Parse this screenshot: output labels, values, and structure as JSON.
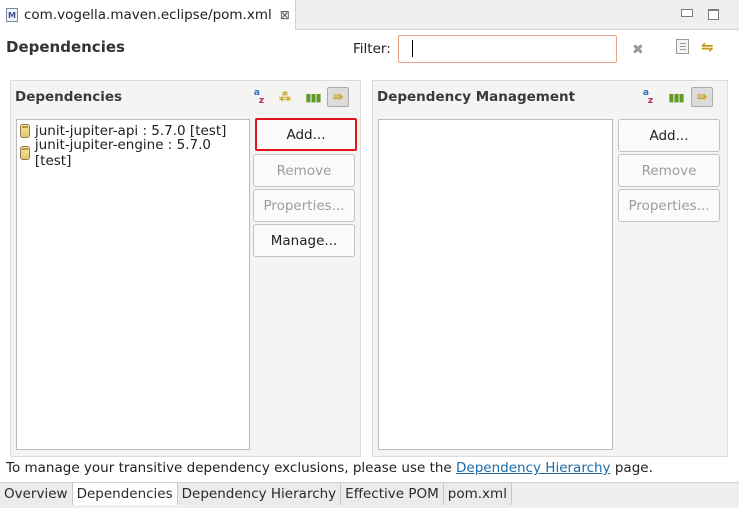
{
  "editor_tab": {
    "icon": "maven-pom-icon",
    "title": "com.vogella.maven.eclipse/pom.xml",
    "close": "⊠"
  },
  "page": {
    "title": "Dependencies",
    "filter_label": "Filter:",
    "filter_value": ""
  },
  "dependencies": {
    "title": "Dependencies",
    "items": [
      {
        "label": "junit-jupiter-api : 5.7.0 [test]"
      },
      {
        "label": "junit-jupiter-engine : 5.7.0 [test]"
      }
    ],
    "buttons": {
      "add": "Add...",
      "remove": "Remove",
      "properties": "Properties...",
      "manage": "Manage..."
    }
  },
  "dependency_management": {
    "title": "Dependency Management",
    "items": [],
    "buttons": {
      "add": "Add...",
      "remove": "Remove",
      "properties": "Properties..."
    }
  },
  "footer": {
    "text_before": "To manage your transitive dependency exclusions, please use the ",
    "link": "Dependency Hierarchy",
    "text_after": " page."
  },
  "bottom_tabs": [
    {
      "label": "Overview"
    },
    {
      "label": "Dependencies"
    },
    {
      "label": "Dependency Hierarchy"
    },
    {
      "label": "Effective POM"
    },
    {
      "label": "pom.xml"
    }
  ],
  "colors": {
    "highlight": "#e0161c",
    "link": "#1b6aa5",
    "filter_border": "#e8a384"
  }
}
